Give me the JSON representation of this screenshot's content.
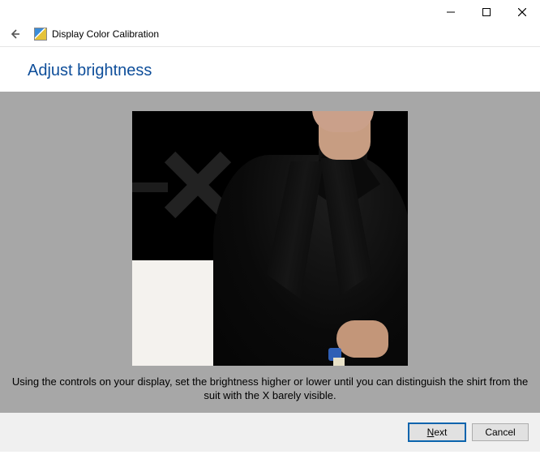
{
  "window": {
    "title": "Display Color Calibration"
  },
  "page": {
    "heading": "Adjust brightness",
    "caption": "Using the controls on your display, set the brightness higher or lower until you can distinguish the shirt from the suit with the X barely visible."
  },
  "buttons": {
    "next": "Next",
    "cancel": "Cancel"
  },
  "icons": {
    "back": "back-arrow-icon",
    "minimize": "minimize-icon",
    "maximize": "maximize-icon",
    "close": "close-icon",
    "app": "display-color-calibration-icon"
  }
}
